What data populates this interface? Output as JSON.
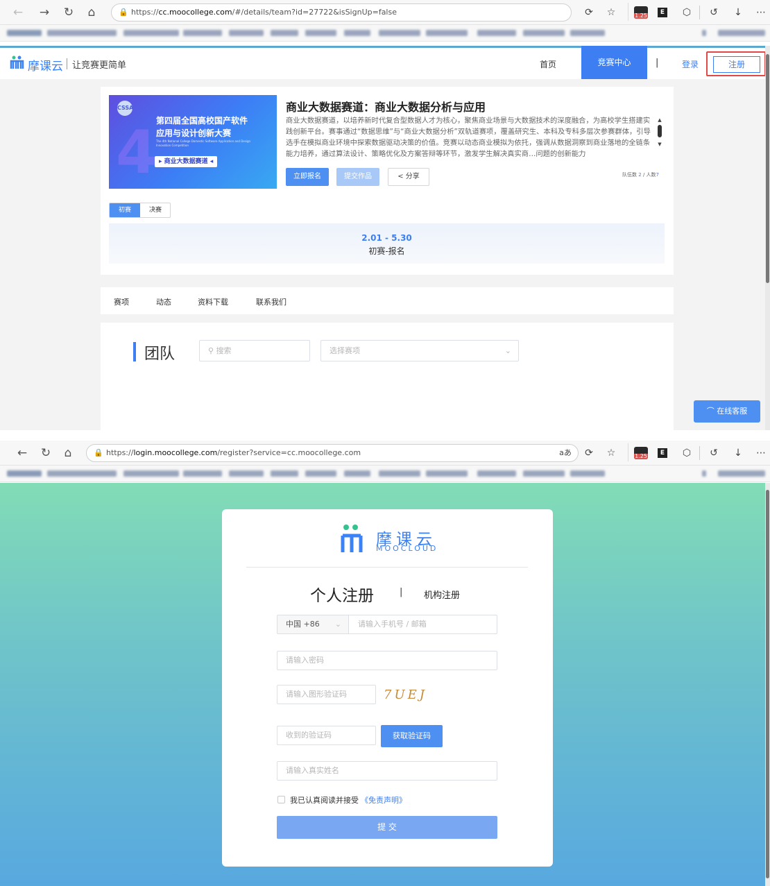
{
  "browser1": {
    "url_prefix": "https://",
    "url_domain": "cc.moocollege.com",
    "url_path": "/#/details/team?id=27722&isSignUp=false",
    "badge": "1.25"
  },
  "site": {
    "logo_text": "摩课云",
    "slogan": "让竞赛更简单",
    "nav": {
      "home": "首页",
      "center": "竞赛中心",
      "sep": "|",
      "login": "登录",
      "register": "注册"
    },
    "banner": {
      "line1": "第四届全国高校国产软件",
      "line2": "应用与设计创新大赛",
      "en": "The 4th National College Domestic Software Application and Design Innovation Competition",
      "tag": "▸ 商业大数据赛道 ◂"
    },
    "contest": {
      "title": "商业大数据赛道：商业大数据分析与应用",
      "desc": "商业大数据赛道，以培养新时代复合型数据人才为核心，聚焦商业场景与大数据技术的深度融合，为高校学生搭建实践创新平台。赛事通过“数据思维”与“商业大数据分析”双轨道赛项，覆盖研究生、本科及专科多层次参赛群体，引导选手在模拟商业环境中探索数据驱动决策的价值。竞赛以动态商业模拟为依托，强调从数据洞察到商业落地的全链条能力培养，通过算法设计、策略优化及方案答辩等环节，激发学生解决真实商…问题的创新能力",
      "btn_signup": "立即报名",
      "btn_submit": "提交作品",
      "btn_share": "分享",
      "team_label": "队伍数",
      "team_count": "2",
      "people_label": "人数",
      "people_count": "7",
      "slash": "/"
    },
    "stage_tabs": [
      "初赛",
      "决赛"
    ],
    "timeline": {
      "date": "2.01 - 5.30",
      "label": "初赛-报名"
    },
    "subnav": [
      "赛项",
      "动态",
      "资料下载",
      "联系我们"
    ],
    "team": {
      "heading": "团队",
      "search_placeholder": "搜索",
      "select_placeholder": "选择赛项"
    },
    "service": "在线客服"
  },
  "browser2": {
    "url_prefix": "https://",
    "url_domain": "login.moocollege.com",
    "url_path": "/register?service=cc.moocollege.com",
    "badge": "1.25"
  },
  "register": {
    "logo_cn": "摩课云",
    "logo_en": "MOOCLOUD",
    "tab_personal": "个人注册",
    "tab_sep": "|",
    "tab_org": "机构注册",
    "country": "中国 +86",
    "phone_placeholder": "请输入手机号 / 邮箱",
    "password_placeholder": "请输入密码",
    "captcha_placeholder": "请输入图形验证码",
    "captcha_text": "7UEJ",
    "sms_placeholder": "收到的验证码",
    "get_code": "获取验证码",
    "name_placeholder": "请输入真实姓名",
    "agree_text": "我已认真阅读并接受",
    "agree_link": "《免责声明》",
    "submit": "提 交"
  }
}
